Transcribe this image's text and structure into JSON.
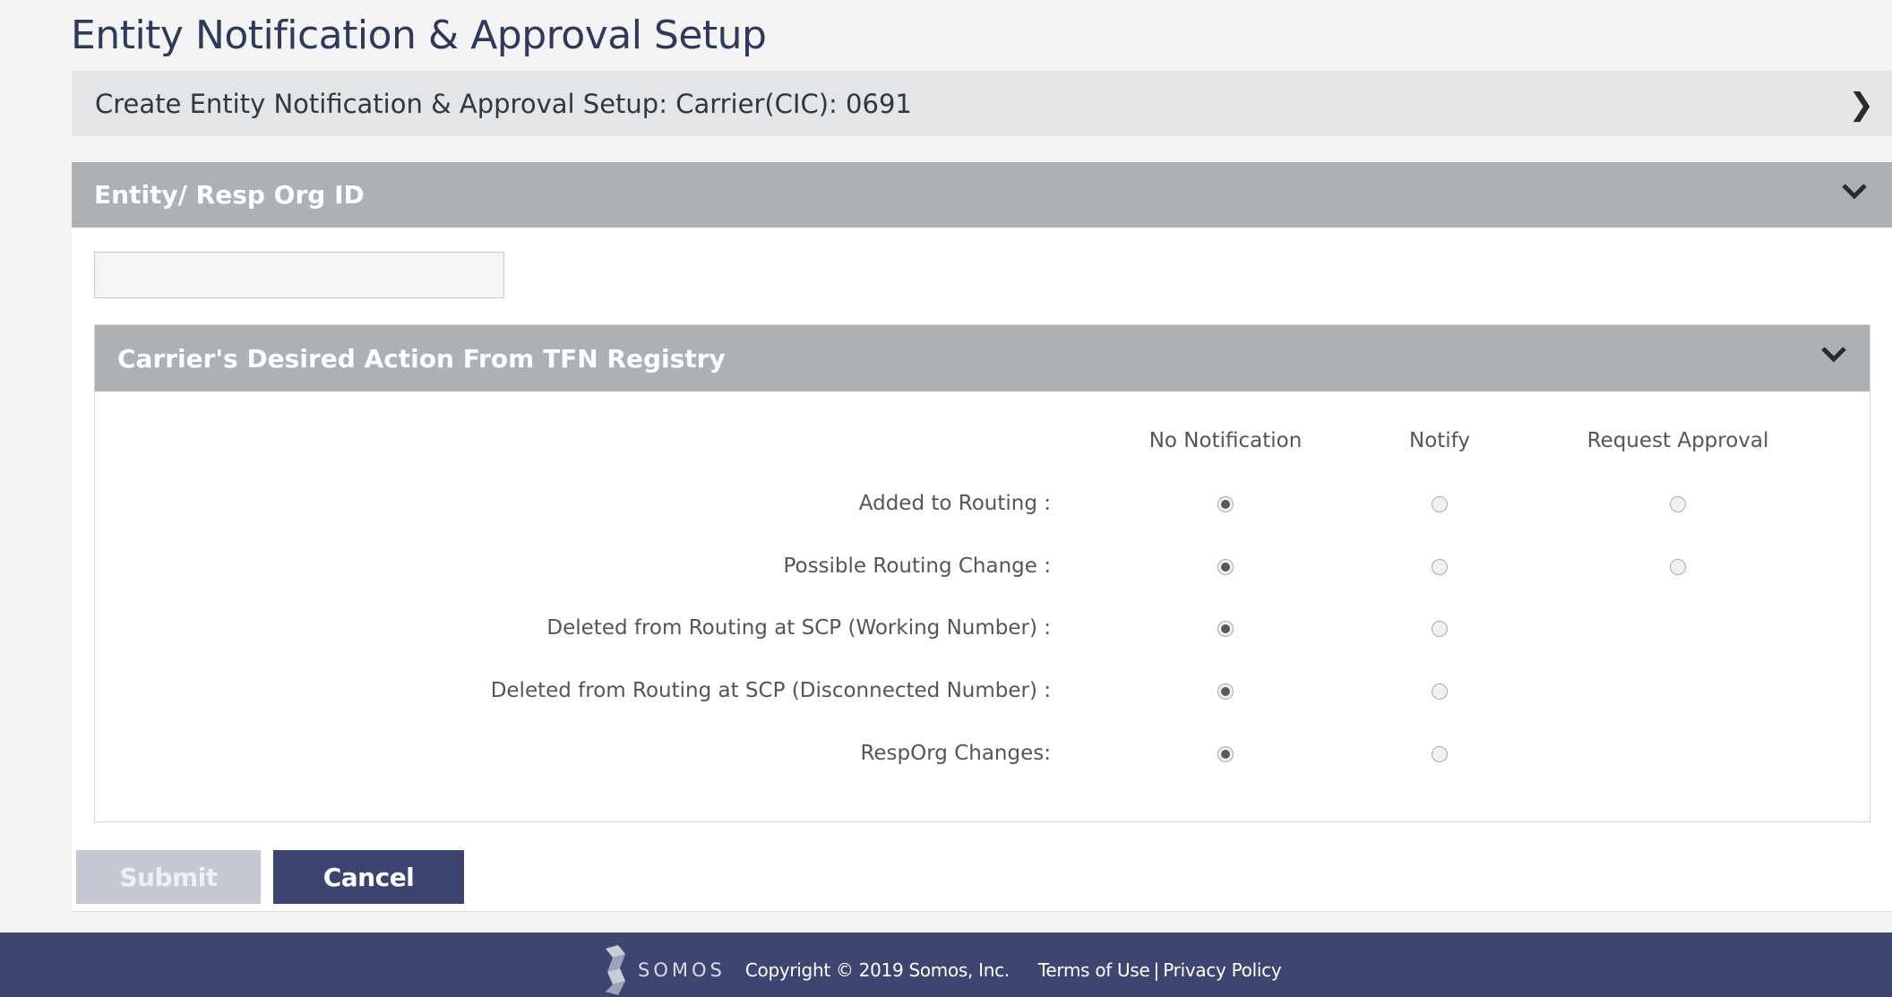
{
  "page": {
    "title": "Entity Notification & Approval Setup"
  },
  "create_bar": {
    "label": "Create Entity Notification & Approval Setup: Carrier(CIC): 0691"
  },
  "entity_section": {
    "title": "Entity/ Resp Org ID",
    "input_value": ""
  },
  "carrier_section": {
    "title": "Carrier's Desired Action From TFN Registry",
    "columns": [
      "No Notification",
      "Notify",
      "Request Approval"
    ],
    "rows": [
      {
        "label": "Added to Routing :",
        "options": [
          "No Notification",
          "Notify",
          "Request Approval"
        ],
        "selected": "No Notification"
      },
      {
        "label": "Possible Routing Change :",
        "options": [
          "No Notification",
          "Notify",
          "Request Approval"
        ],
        "selected": "No Notification"
      },
      {
        "label": "Deleted from Routing at SCP (Working Number) :",
        "options": [
          "No Notification",
          "Notify"
        ],
        "selected": "No Notification"
      },
      {
        "label": "Deleted from Routing at SCP (Disconnected Number) :",
        "options": [
          "No Notification",
          "Notify"
        ],
        "selected": "No Notification"
      },
      {
        "label": "RespOrg Changes:",
        "options": [
          "No Notification",
          "Notify"
        ],
        "selected": "No Notification"
      }
    ]
  },
  "buttons": {
    "submit": "Submit",
    "cancel": "Cancel"
  },
  "footer": {
    "logo_text": "SOMOS",
    "copyright": "Copyright © 2019 Somos, Inc.",
    "terms": "Terms of Use",
    "separator": "|",
    "privacy": "Privacy Policy"
  },
  "colors": {
    "header_bar": "#abb1b4",
    "create_bar": "#e3e5e6",
    "primary": "#3b4570",
    "disabled": "#c5c8d4",
    "footer": "#3c4670"
  },
  "icons": {
    "create_bar": "chevron-right-icon",
    "sections": "chevron-down-icon",
    "logo": "somos-logo-icon"
  }
}
